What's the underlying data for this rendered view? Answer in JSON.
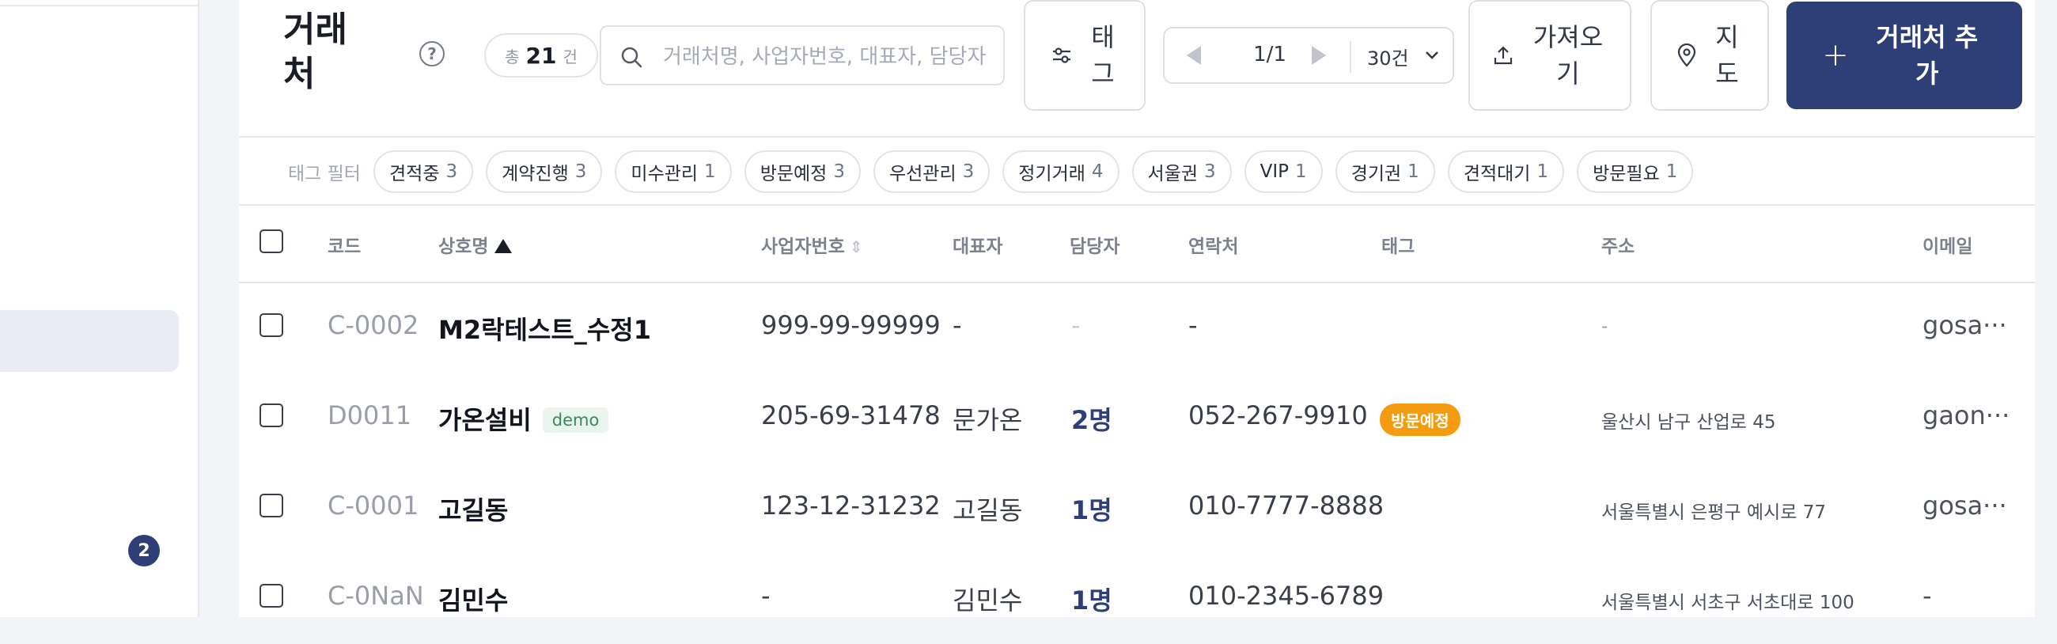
{
  "sidebar": {
    "badge_count": "2"
  },
  "header": {
    "title": "거래처",
    "help_icon": "question-circle-icon",
    "count": {
      "prefix": "총",
      "value": "21",
      "suffix": "건"
    },
    "search": {
      "placeholder": "거래처명, 사업자번호, 대표자, 담당자"
    },
    "tag_button": "태그",
    "pager": {
      "page": "1/1",
      "page_size": "30건"
    },
    "import_button": "가져오기",
    "map_button": "지도",
    "add_button": "거래처 추가",
    "accent_color": "#2e3f78"
  },
  "tag_filter": {
    "label": "태그 필터",
    "chips": [
      {
        "name": "견적중",
        "count": "3"
      },
      {
        "name": "계약진행",
        "count": "3"
      },
      {
        "name": "미수관리",
        "count": "1"
      },
      {
        "name": "방문예정",
        "count": "3"
      },
      {
        "name": "우선관리",
        "count": "3"
      },
      {
        "name": "정기거래",
        "count": "4"
      },
      {
        "name": "서울권",
        "count": "3"
      },
      {
        "name": "VIP",
        "count": "1"
      },
      {
        "name": "경기권",
        "count": "1"
      },
      {
        "name": "견적대기",
        "count": "1"
      },
      {
        "name": "방문필요",
        "count": "1"
      }
    ]
  },
  "table": {
    "columns": {
      "code": "코드",
      "name": "상호명",
      "biz_no": "사업자번호",
      "ceo": "대표자",
      "manager": "담당자",
      "contact": "연락처",
      "tag": "태그",
      "address": "주소",
      "email": "이메일"
    },
    "rows": [
      {
        "code": "C-0002",
        "name": "M2락테스트_수정1",
        "biz_no": "999-99-99999",
        "ceo": "-",
        "manager": "-",
        "contact": "-",
        "tag": "",
        "address": "-",
        "email": "gosa···"
      },
      {
        "code": "D0011",
        "name": "가온설비",
        "badge": "demo",
        "biz_no": "205-69-31478",
        "ceo": "문가온",
        "manager": "2명",
        "contact": "052-267-9910",
        "tag": "방문예정",
        "tag_color": "#f39c12",
        "address": "울산시 남구 산업로 45",
        "email": "gaon···"
      },
      {
        "code": "C-0001",
        "name": "고길동",
        "biz_no": "123-12-31232",
        "ceo": "고길동",
        "manager": "1명",
        "contact": "010-7777-8888",
        "tag": "",
        "address": "서울특별시 은평구 예시로 77",
        "email": "gosa···"
      },
      {
        "code": "C-0NaN",
        "name": "김민수",
        "biz_no": "-",
        "ceo": "김민수",
        "manager": "1명",
        "contact": "010-2345-6789",
        "tag": "",
        "address": "서울특별시 서초구 서초대로 100",
        "email": "-"
      }
    ]
  }
}
